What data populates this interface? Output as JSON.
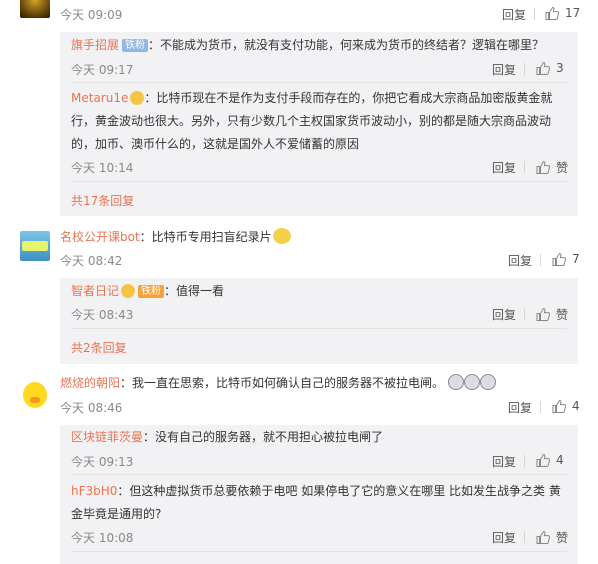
{
  "c1": {
    "time": "今天 09:09",
    "reply": "回复",
    "likes": "17"
  },
  "c1_sub1": {
    "user": "旗手招展",
    "badge": "铁粉",
    "text": "：不能成为货币，就没有支付功能，何来成为货币的终结者？逻辑在哪里？",
    "time": "今天 09:17",
    "reply": "回复",
    "likes": "3"
  },
  "c1_sub2": {
    "user": "Metaru1e",
    "text": "：比特币现在不是作为支付手段而存在的，你把它看成大宗商品加密版黄金就行，黄金波动也很大。另外，只有少数几个主权国家货币波动小，别的都是随大宗商品波动的，加币、澳币什么的，这就是国外人不爱储蓄的原因",
    "time": "今天 10:14",
    "reply": "回复",
    "likes": "赞"
  },
  "c1_more": "共17条回复",
  "c2": {
    "user": "名校公开课bot",
    "text": "：比特币专用扫盲纪录片",
    "time": "今天 08:42",
    "reply": "回复",
    "likes": "7"
  },
  "c2_sub1": {
    "user": "智者日记",
    "badge": "铁粉",
    "text": "：值得一看",
    "time": "今天 08:43",
    "reply": "回复",
    "likes": "赞"
  },
  "c2_more": "共2条回复",
  "c3": {
    "user": "燃烧的朝阳",
    "text": "：我一直在思索，比特币如何确认自己的服务器不被拉电闸。",
    "time": "今天 08:46",
    "reply": "回复",
    "likes": "4"
  },
  "c3_sub1": {
    "user": "区块链菲茨曼",
    "text": "：没有自己的服务器，就不用担心被拉电闸了",
    "time": "今天 09:13",
    "reply": "回复",
    "likes": "4"
  },
  "c3_sub2": {
    "user": "hF3bH0",
    "text": "：但这种虚拟货币总要依赖于电吧 如果停电了它的意义在哪里 比如发生战争之类 黄金毕竟是通用的?",
    "time": "今天 10:08",
    "reply": "回复",
    "likes": "赞"
  },
  "icons": {
    "like": "thumbs-up-icon",
    "emoji": "face-emoji-icon",
    "crown": "crown-icon"
  },
  "colors": {
    "username": "#eb7350",
    "subbox": "#f2f2f5",
    "badge": "#91b7e6"
  }
}
